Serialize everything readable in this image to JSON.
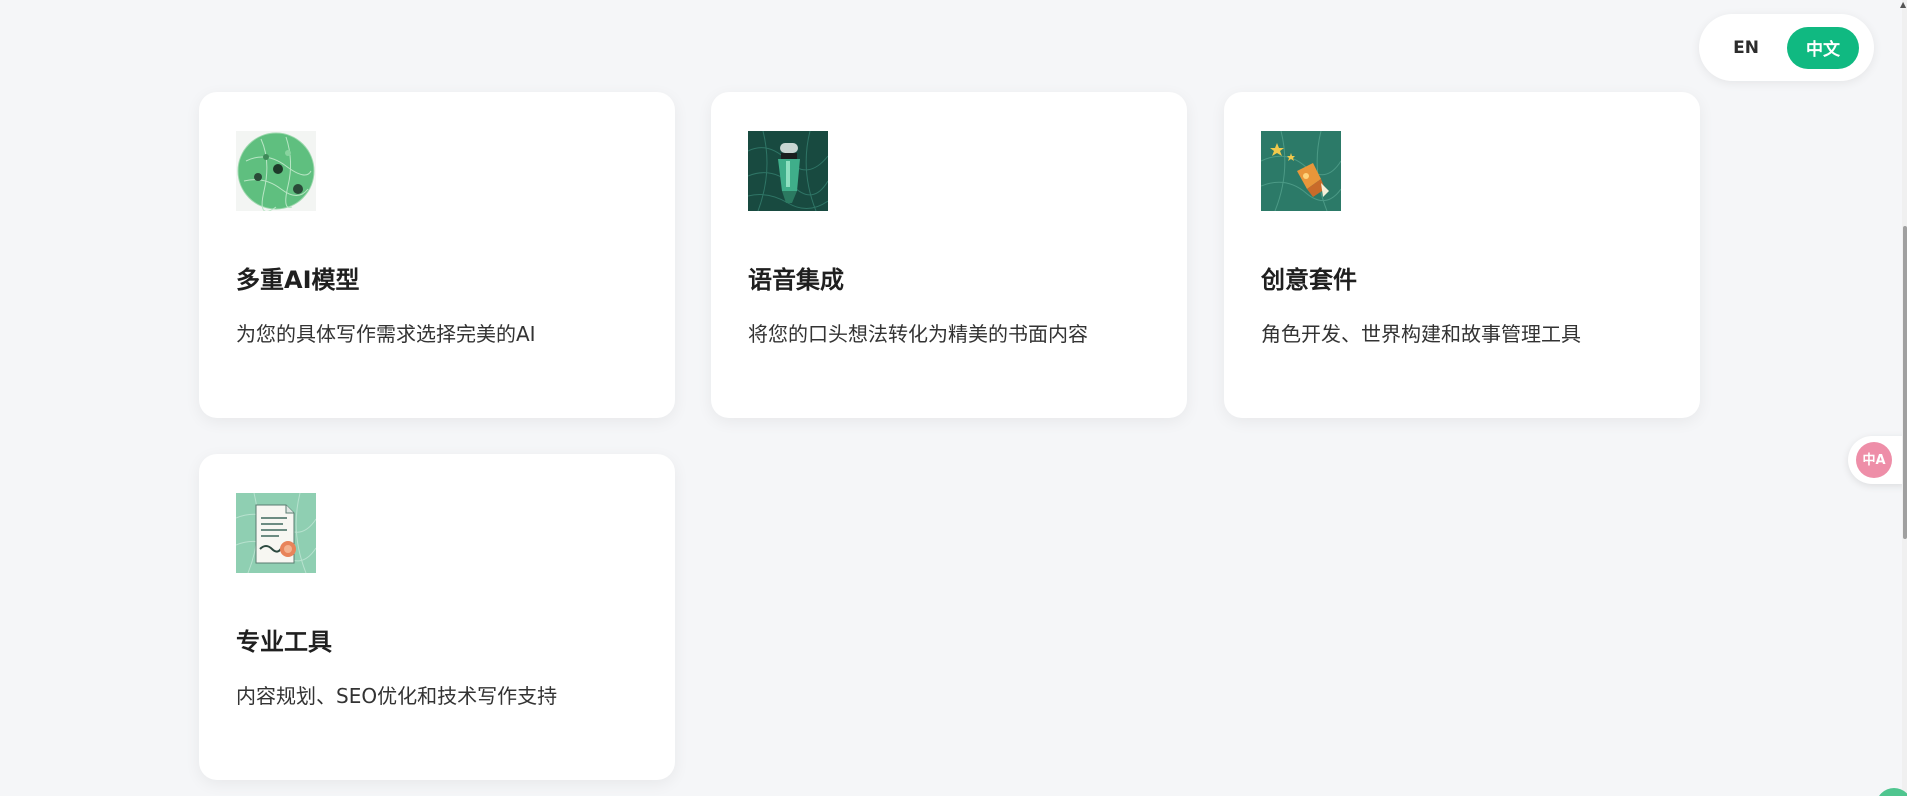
{
  "language_toggle": {
    "en_label": "EN",
    "zh_label": "中文",
    "active": "zh",
    "accent_color": "#10b981"
  },
  "features": [
    {
      "icon": "green-planet-icon",
      "title": "多重AI模型",
      "description": "为您的具体写作需求选择完美的AI"
    },
    {
      "icon": "microphone-icon",
      "title": "语音集成",
      "description": "将您的口头想法转化为精美的书面内容"
    },
    {
      "icon": "creative-pen-icon",
      "title": "创意套件",
      "description": "角色开发、世界构建和故事管理工具"
    },
    {
      "icon": "document-icon",
      "title": "专业工具",
      "description": "内容规划、SEO优化和技术写作支持"
    }
  ],
  "translate_widget": {
    "icon": "translate-icon",
    "glyph": "中A",
    "color": "#ee8ea8"
  }
}
